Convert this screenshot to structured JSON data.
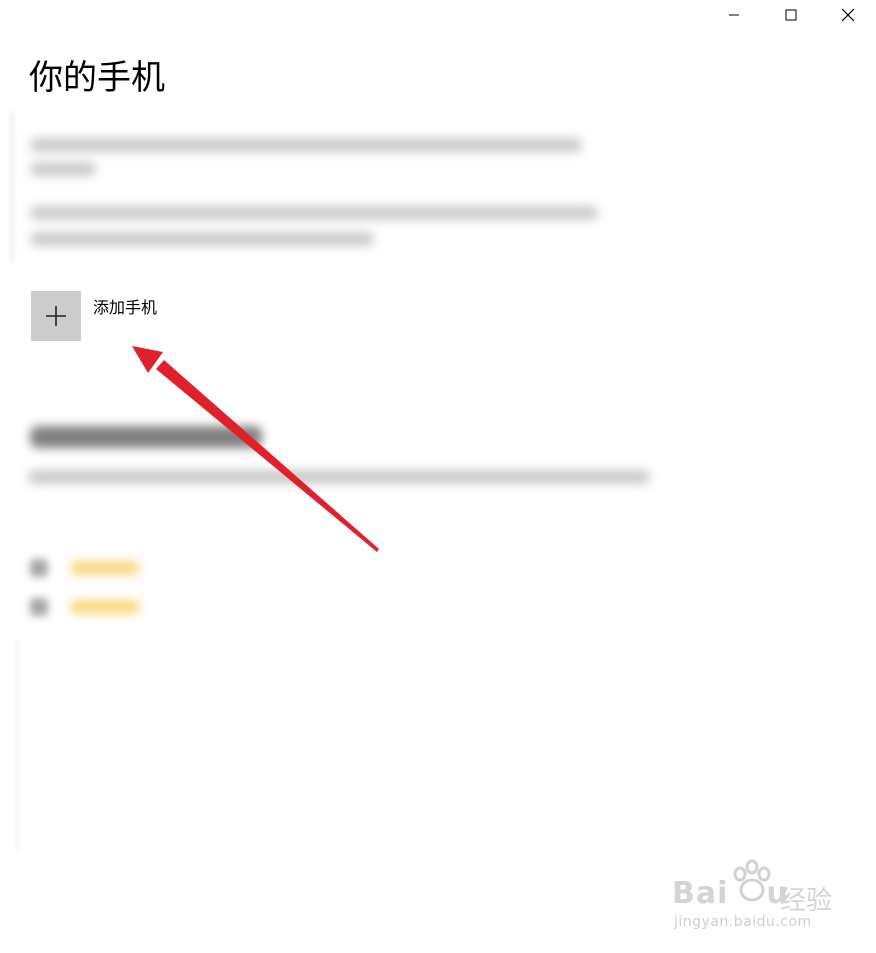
{
  "window": {
    "controls": {
      "minimize": "minimize-icon",
      "maximize": "maximize-icon",
      "close": "close-icon"
    }
  },
  "page": {
    "title": "你的手机"
  },
  "add_phone": {
    "icon": "plus-icon",
    "label": "添加手机"
  },
  "colors": {
    "tile_background": "#cccccc",
    "arrow": "#e0202a",
    "link_accent": "#f6c84a"
  },
  "watermark": {
    "brand": "Bai",
    "brand_tail": "u",
    "product": "经验",
    "url": "jingyan.baidu.com"
  }
}
